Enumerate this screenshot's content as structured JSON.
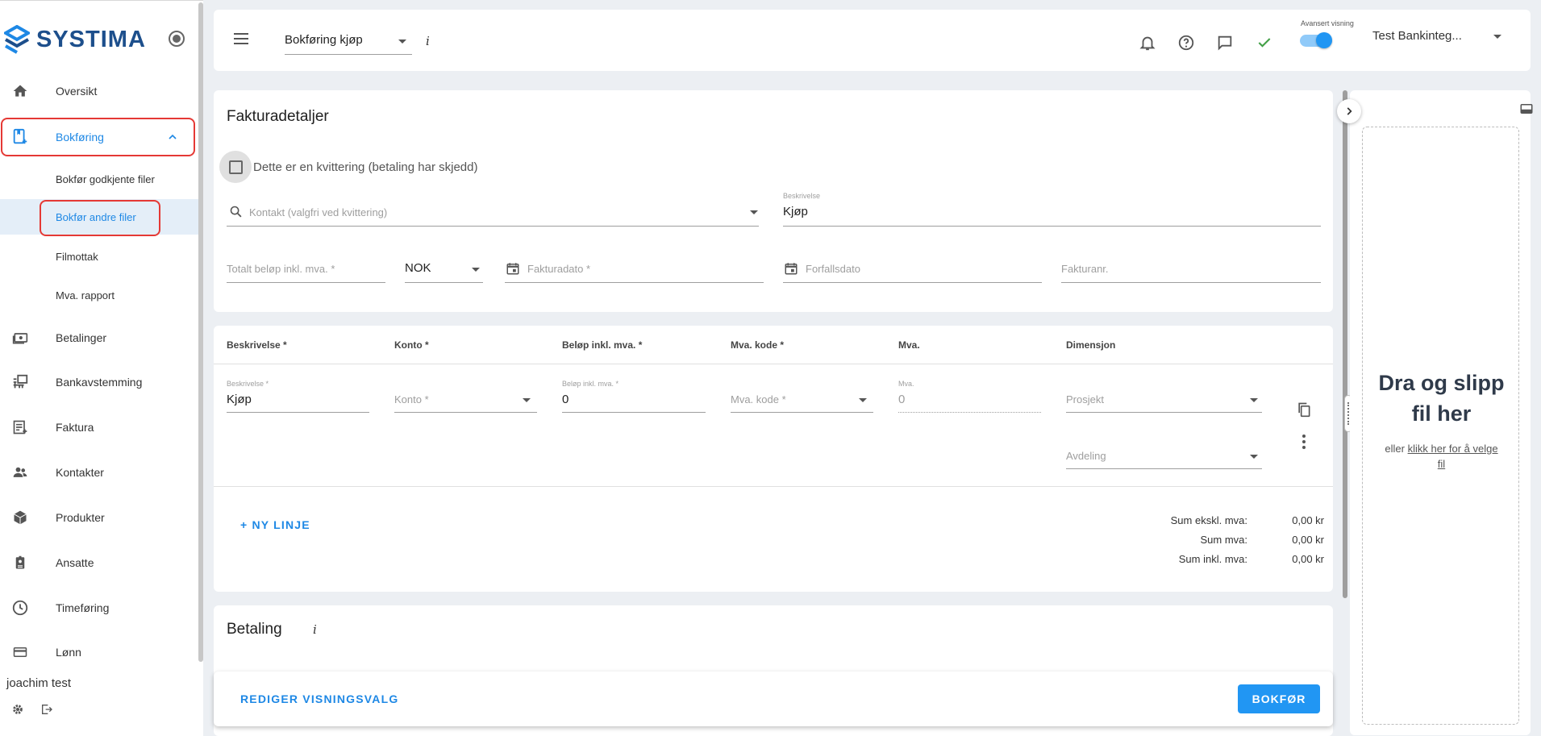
{
  "sidebar": {
    "brand": "SYSTIMA",
    "items": [
      {
        "label": "Oversikt",
        "icon": "home-icon"
      },
      {
        "label": "Bokføring",
        "icon": "bookkeeping-icon"
      },
      {
        "label": "Betalinger",
        "icon": "payments-icon"
      },
      {
        "label": "Bankavstemming",
        "icon": "bank-reconcile-icon"
      },
      {
        "label": "Faktura",
        "icon": "invoice-icon"
      },
      {
        "label": "Kontakter",
        "icon": "contacts-icon"
      },
      {
        "label": "Produkter",
        "icon": "products-icon"
      },
      {
        "label": "Ansatte",
        "icon": "employees-icon"
      },
      {
        "label": "Timeføring",
        "icon": "clock-icon"
      },
      {
        "label": "Lønn",
        "icon": "payroll-icon"
      }
    ],
    "subitems": [
      {
        "label": "Bokfør godkjente filer"
      },
      {
        "label": "Bokfør andre filer"
      },
      {
        "label": "Filmottak"
      },
      {
        "label": "Mva. rapport"
      }
    ],
    "user": "joachim test"
  },
  "topbar": {
    "view_select": "Bokføring kjøp",
    "info": "i",
    "advanced_label": "Avansert visning",
    "company": "Test Bankinteg..."
  },
  "invoice": {
    "title": "Fakturadetaljer",
    "receipt_checkbox": "Dette er en kvittering (betaling har skjedd)",
    "contact_placeholder": "Kontakt (valgfri ved kvittering)",
    "description_label": "Beskrivelse",
    "description_value": "Kjøp",
    "total_placeholder": "Totalt beløp inkl. mva. *",
    "currency": "NOK",
    "invoice_date_placeholder": "Fakturadato *",
    "due_date_placeholder": "Forfallsdato",
    "invoice_no_placeholder": "Fakturanr."
  },
  "lines": {
    "headers": [
      "Beskrivelse *",
      "Konto *",
      "Beløp inkl. mva. *",
      "Mva. kode *",
      "Mva.",
      "Dimensjon"
    ],
    "row": {
      "desc_label": "Beskrivelse *",
      "desc_value": "Kjøp",
      "account_placeholder": "Konto *",
      "amount_label": "Beløp inkl. mva. *",
      "amount_value": "0",
      "vat_code_placeholder": "Mva. kode *",
      "vat_label": "Mva.",
      "vat_value": "0",
      "project_placeholder": "Prosjekt",
      "department_placeholder": "Avdeling"
    },
    "new_line": "+ NY LINJE",
    "sums": [
      {
        "label": "Sum ekskl. mva:",
        "value": "0,00 kr"
      },
      {
        "label": "Sum mva:",
        "value": "0,00 kr"
      },
      {
        "label": "Sum inkl. mva:",
        "value": "0,00 kr"
      }
    ]
  },
  "payment": {
    "title": "Betaling",
    "info": "i"
  },
  "footer": {
    "edit_view": "REDIGER VISNINGSVALG",
    "submit": "BOKFØR"
  },
  "dropzone": {
    "title": "Dra og slipp fil her",
    "prefix": "eller",
    "link": "klikk her for å velge fil"
  },
  "colors": {
    "accent": "#2196f3",
    "brand": "#1d4f8c",
    "highlight": "#e53935",
    "success": "#43a047"
  }
}
